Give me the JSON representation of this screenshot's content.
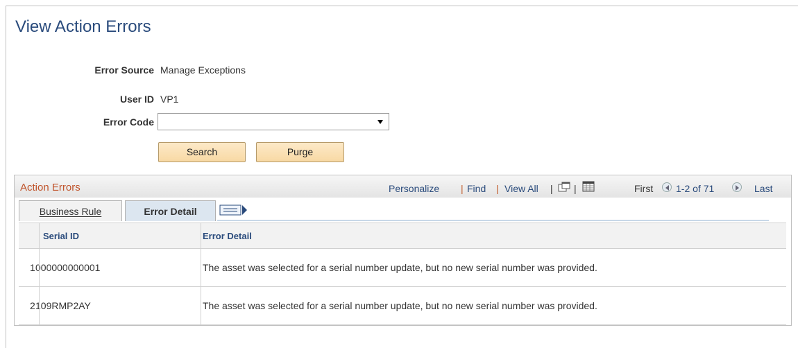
{
  "page": {
    "title": "View Action Errors"
  },
  "form": {
    "error_source_label": "Error Source",
    "error_source_value": "Manage Exceptions",
    "user_id_label": "User ID",
    "user_id_value": "VP1",
    "error_code_label": "Error Code",
    "error_code_value": "",
    "search_label": "Search",
    "purge_label": "Purge"
  },
  "grid": {
    "title": "Action Errors",
    "personalize": "Personalize",
    "find": "Find",
    "view_all": "View All",
    "separator": "|",
    "first": "First",
    "range": "1-2 of 71",
    "last": "Last",
    "tabs": [
      {
        "label": "Business Rule",
        "active": false
      },
      {
        "label": "Error Detail",
        "active": true
      }
    ],
    "columns": [
      "Serial ID",
      "Error Detail"
    ],
    "rows": [
      {
        "num": "1",
        "serial_id": "000000000001",
        "detail": "The asset was selected for a serial number update, but no new serial number was provided."
      },
      {
        "num": "2",
        "serial_id": "109RMP2AY",
        "detail": "The asset was selected for a serial number update, but no new serial number was provided."
      }
    ]
  },
  "colors": {
    "title": "#2a4b7c",
    "grid_title": "#c0532a",
    "link": "#2a4b7c",
    "button": "#f8d9a4"
  }
}
